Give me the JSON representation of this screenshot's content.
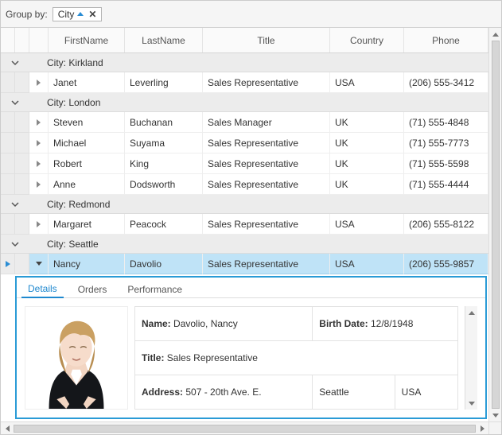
{
  "group_panel": {
    "label": "Group by:",
    "tag": "City"
  },
  "columns": {
    "firstName": "FirstName",
    "lastName": "LastName",
    "title": "Title",
    "country": "Country",
    "phone": "Phone"
  },
  "groups": [
    {
      "header": "City: Kirkland",
      "rows": [
        {
          "first": "Janet",
          "last": "Leverling",
          "title": "Sales Representative",
          "country": "USA",
          "phone": "(206) 555-3412"
        }
      ]
    },
    {
      "header": "City: London",
      "rows": [
        {
          "first": "Steven",
          "last": "Buchanan",
          "title": "Sales Manager",
          "country": "UK",
          "phone": "(71) 555-4848"
        },
        {
          "first": "Michael",
          "last": "Suyama",
          "title": "Sales Representative",
          "country": "UK",
          "phone": "(71) 555-7773"
        },
        {
          "first": "Robert",
          "last": "King",
          "title": "Sales Representative",
          "country": "UK",
          "phone": "(71) 555-5598"
        },
        {
          "first": "Anne",
          "last": "Dodsworth",
          "title": "Sales Representative",
          "country": "UK",
          "phone": "(71) 555-4444"
        }
      ]
    },
    {
      "header": "City: Redmond",
      "rows": [
        {
          "first": "Margaret",
          "last": "Peacock",
          "title": "Sales Representative",
          "country": "USA",
          "phone": "(206) 555-8122"
        }
      ]
    },
    {
      "header": "City: Seattle",
      "rows": [
        {
          "first": "Nancy",
          "last": "Davolio",
          "title": "Sales Representative",
          "country": "USA",
          "phone": "(206) 555-9857",
          "selected": true,
          "expanded": true
        }
      ]
    }
  ],
  "tabs": {
    "t0": "Details",
    "t1": "Orders",
    "t2": "Performance"
  },
  "detail": {
    "name_label": "Name:",
    "name_value": "Davolio, Nancy",
    "birth_label": "Birth Date:",
    "birth_value": "12/8/1948",
    "title_label": "Title:",
    "title_value": "Sales Representative",
    "address_label": "Address:",
    "address_value": "507 - 20th Ave. E.",
    "city_value": "Seattle",
    "country_value": "USA"
  }
}
